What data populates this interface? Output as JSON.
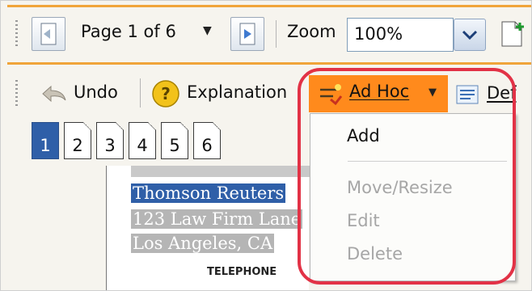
{
  "toolbar1": {
    "page_label": "Page 1 of 6",
    "zoom_label": "Zoom",
    "zoom_value": "100%"
  },
  "toolbar2": {
    "undo_label": "Undo",
    "explanation_label": "Explanation",
    "adhoc_label": "Ad Hoc",
    "def_label": "Def"
  },
  "pages": [
    "1",
    "2",
    "3",
    "4",
    "5",
    "6"
  ],
  "document": {
    "lines": [
      "Thomson Reuters",
      "123 Law Firm Lane",
      "Los Angeles, CA"
    ],
    "telephone_label": "TELEPHONE"
  },
  "adhoc_menu": {
    "items": [
      {
        "label": "Add",
        "enabled": true
      },
      {
        "label": "Move/Resize",
        "enabled": false
      },
      {
        "label": "Edit",
        "enabled": false
      },
      {
        "label": "Delete",
        "enabled": false
      }
    ]
  },
  "colors": {
    "accent": "#f0a43a",
    "adhoc_highlight": "#ff8a1c",
    "annotation_circle": "#e23246",
    "selection": "#2f5fa8",
    "disabled_text": "#a6a6a6"
  }
}
